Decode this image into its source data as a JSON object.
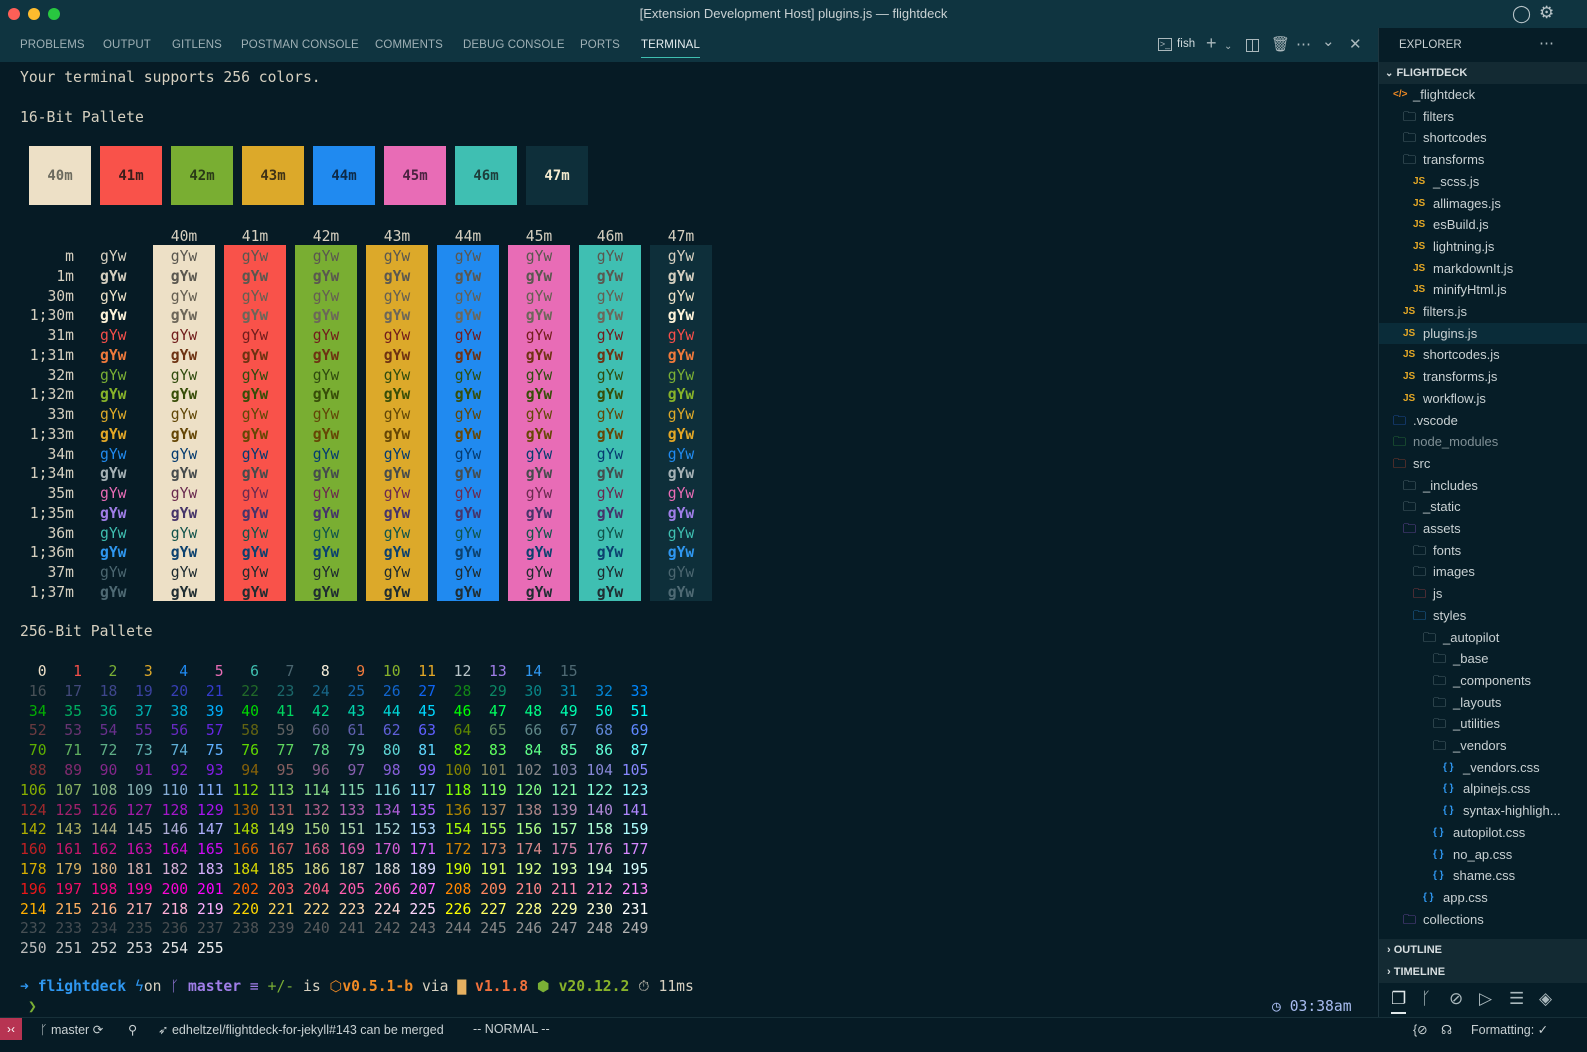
{
  "window": {
    "title": "[Extension Development Host] plugins.js — flightdeck"
  },
  "panel": {
    "tabs": [
      {
        "label": "PROBLEMS"
      },
      {
        "label": "OUTPUT"
      },
      {
        "label": "GITLENS"
      },
      {
        "label": "POSTMAN CONSOLE"
      },
      {
        "label": "COMMENTS"
      },
      {
        "label": "DEBUG CONSOLE"
      },
      {
        "label": "PORTS"
      },
      {
        "label": "TERMINAL",
        "active": true
      }
    ],
    "shell_name": "fish"
  },
  "terminal": {
    "intro": "Your terminal supports 256 colors.",
    "heading16": "16-Bit Pallete",
    "heading256": "256-Bit Pallete",
    "swatches": [
      {
        "label": "40m",
        "bg": "#ede0c6",
        "fg": "#6b6a5e"
      },
      {
        "label": "41m",
        "bg": "#f9524a",
        "fg": "#3a1d1a"
      },
      {
        "label": "42m",
        "bg": "#79ae32",
        "fg": "#2a3a17"
      },
      {
        "label": "43m",
        "bg": "#dca92a",
        "fg": "#3f3216"
      },
      {
        "label": "44m",
        "bg": "#208af0",
        "fg": "#0d2a48"
      },
      {
        "label": "45m",
        "bg": "#e86cb6",
        "fg": "#4a2240"
      },
      {
        "label": "46m",
        "bg": "#3fbfb2",
        "fg": "#1d3d3a"
      },
      {
        "label": "47m",
        "bg": "#0e2f3a",
        "fg": "#f5ecd0"
      }
    ],
    "table": {
      "sample": "gYw",
      "rows": [
        {
          "label": "m",
          "fg": "#d6d0c0",
          "bold": false
        },
        {
          "label": "1m",
          "fg": "#d6d0c0",
          "bold": true
        },
        {
          "label": "30m",
          "fg": "#eee2c8",
          "bold": false
        },
        {
          "label": "1;30m",
          "fg": "#fff4da",
          "bold": true
        },
        {
          "label": "31m",
          "fg": "#f44f4a",
          "bold": false
        },
        {
          "label": "1;31m",
          "fg": "#f07a3c",
          "bold": true
        },
        {
          "label": "32m",
          "fg": "#7aaf35",
          "bold": false
        },
        {
          "label": "1;32m",
          "fg": "#88b32a",
          "bold": true
        },
        {
          "label": "33m",
          "fg": "#dca92a",
          "bold": false
        },
        {
          "label": "1;33m",
          "fg": "#e4a826",
          "bold": true
        },
        {
          "label": "34m",
          "fg": "#208af0",
          "bold": false
        },
        {
          "label": "1;34m",
          "fg": "#a6b2b6",
          "bold": true
        },
        {
          "label": "35m",
          "fg": "#e86cb5",
          "bold": false
        },
        {
          "label": "1;35m",
          "fg": "#a07ee8",
          "bold": true
        },
        {
          "label": "36m",
          "fg": "#3fbfb0",
          "bold": false
        },
        {
          "label": "1;36m",
          "fg": "#2f97f0",
          "bold": true
        },
        {
          "label": "37m",
          "fg": "#4b6670",
          "bold": false
        },
        {
          "label": "1;37m",
          "fg": "#4f6a74",
          "bold": true
        }
      ]
    },
    "palette256": {
      "base16": [
        "#eee0c8",
        "#f44f4a",
        "#7aaf35",
        "#dca92a",
        "#208af0",
        "#e86cb5",
        "#3fbfb0",
        "#4b6670",
        "#f5ecd8",
        "#f07a3c",
        "#88b32a",
        "#e4a826",
        "#b8c4c8",
        "#a07ee8",
        "#2f97f0",
        "#4f6a74"
      ],
      "numbers": [
        0,
        1,
        2,
        3,
        4,
        5,
        6,
        7,
        8,
        9,
        10,
        11,
        12,
        13,
        14,
        15,
        16,
        17,
        18,
        19,
        20,
        21,
        22,
        23,
        24,
        25,
        26,
        27,
        28,
        29,
        30,
        31,
        32,
        33,
        34,
        35,
        36,
        37,
        38,
        39,
        40,
        41,
        42,
        43,
        44,
        45,
        46,
        47,
        48,
        49,
        50,
        51,
        52,
        53,
        54,
        55,
        56,
        57,
        58,
        59,
        60,
        61,
        62,
        63,
        64,
        65,
        66,
        67,
        68,
        69,
        70,
        71,
        72,
        73,
        74,
        75,
        76,
        77,
        78,
        79,
        80,
        81,
        82,
        83,
        84,
        85,
        86,
        87,
        88,
        89,
        90,
        91,
        92,
        93,
        94,
        95,
        96,
        97,
        98,
        99,
        100,
        101,
        102,
        103,
        104,
        105,
        106,
        107,
        108,
        109,
        110,
        111,
        112,
        113,
        114,
        115,
        116,
        117,
        118,
        119,
        120,
        121,
        122,
        123,
        124,
        125,
        126,
        127,
        128,
        129,
        130,
        131,
        132,
        133,
        134,
        135,
        136,
        137,
        138,
        139,
        140,
        141,
        142,
        143,
        144,
        145,
        146,
        147,
        148,
        149,
        150,
        151,
        152,
        153,
        154,
        155,
        156,
        157,
        158,
        159,
        160,
        161,
        162,
        163,
        164,
        165,
        166,
        167,
        168,
        169,
        170,
        171,
        172,
        173,
        174,
        175,
        176,
        177,
        178,
        179,
        180,
        181,
        182,
        183,
        184,
        185,
        186,
        187,
        188,
        189,
        190,
        191,
        192,
        193,
        194,
        195,
        196,
        197,
        198,
        199,
        200,
        201,
        202,
        203,
        204,
        205,
        206,
        207,
        208,
        209,
        210,
        211,
        212,
        213,
        214,
        215,
        216,
        217,
        218,
        219,
        220,
        221,
        222,
        223,
        224,
        225,
        226,
        227,
        228,
        229,
        230,
        231,
        232,
        233,
        234,
        235,
        236,
        237,
        238,
        239,
        240,
        241,
        242,
        243,
        244,
        245,
        246,
        247,
        248,
        249,
        250,
        251,
        252,
        253,
        254,
        255
      ]
    },
    "prompt": {
      "arrow": "➜",
      "dir": "flightdeck",
      "on": "on",
      "branch": "master",
      "git_status": "≡",
      "diff": "+/-",
      "is": "is",
      "pkg_version": "v0.5.1-b",
      "via": "via",
      "bun_version": "v1.1.8",
      "node_version": "v20.12.2",
      "duration": "11ms",
      "caret": "❯",
      "clock": "03:38am"
    }
  },
  "explorer": {
    "title": "EXPLORER",
    "root": "FLIGHTDECK",
    "items": [
      {
        "name": "_flightdeck",
        "level": 0,
        "icon": "code-folder"
      },
      {
        "name": "filters",
        "level": 1,
        "icon": "folder"
      },
      {
        "name": "shortcodes",
        "level": 1,
        "icon": "folder"
      },
      {
        "name": "transforms",
        "level": 1,
        "icon": "folder"
      },
      {
        "name": "_scss.js",
        "level": 2,
        "icon": "js"
      },
      {
        "name": "allimages.js",
        "level": 2,
        "icon": "js"
      },
      {
        "name": "esBuild.js",
        "level": 2,
        "icon": "js"
      },
      {
        "name": "lightning.js",
        "level": 2,
        "icon": "js"
      },
      {
        "name": "markdownIt.js",
        "level": 2,
        "icon": "js"
      },
      {
        "name": "minifyHtml.js",
        "level": 2,
        "icon": "js"
      },
      {
        "name": "filters.js",
        "level": 1,
        "icon": "js"
      },
      {
        "name": "plugins.js",
        "level": 1,
        "icon": "js",
        "selected": true
      },
      {
        "name": "shortcodes.js",
        "level": 1,
        "icon": "js"
      },
      {
        "name": "transforms.js",
        "level": 1,
        "icon": "js"
      },
      {
        "name": "workflow.js",
        "level": 1,
        "icon": "js"
      },
      {
        "name": ".vscode",
        "level": 0,
        "icon": "folder-vscode"
      },
      {
        "name": "node_modules",
        "level": 0,
        "icon": "folder-node",
        "dim": true
      },
      {
        "name": "src",
        "level": 0,
        "icon": "folder-src"
      },
      {
        "name": "_includes",
        "level": 1,
        "icon": "folder"
      },
      {
        "name": "_static",
        "level": 1,
        "icon": "folder"
      },
      {
        "name": "assets",
        "level": 1,
        "icon": "folder-assets"
      },
      {
        "name": "fonts",
        "level": 2,
        "icon": "folder"
      },
      {
        "name": "images",
        "level": 2,
        "icon": "folder"
      },
      {
        "name": "js",
        "level": 2,
        "icon": "folder-js"
      },
      {
        "name": "styles",
        "level": 2,
        "icon": "folder-styles"
      },
      {
        "name": "_autopilot",
        "level": 3,
        "icon": "folder"
      },
      {
        "name": "_base",
        "level": 4,
        "icon": "folder"
      },
      {
        "name": "_components",
        "level": 4,
        "icon": "folder"
      },
      {
        "name": "_layouts",
        "level": 4,
        "icon": "folder"
      },
      {
        "name": "_utilities",
        "level": 4,
        "icon": "folder"
      },
      {
        "name": "_vendors",
        "level": 4,
        "icon": "folder"
      },
      {
        "name": "_vendors.css",
        "level": 5,
        "icon": "css"
      },
      {
        "name": "alpinejs.css",
        "level": 5,
        "icon": "css"
      },
      {
        "name": "syntax-highligh...",
        "level": 5,
        "icon": "css"
      },
      {
        "name": "autopilot.css",
        "level": 4,
        "icon": "css"
      },
      {
        "name": "no_ap.css",
        "level": 4,
        "icon": "css"
      },
      {
        "name": "shame.css",
        "level": 4,
        "icon": "css"
      },
      {
        "name": "app.css",
        "level": 3,
        "icon": "css"
      },
      {
        "name": "collections",
        "level": 1,
        "icon": "folder-collections"
      }
    ],
    "outline": "OUTLINE",
    "timeline": "TIMELINE"
  },
  "statusbar": {
    "branch": "master",
    "pr": "edheltzel/flightdeck-for-jekyll#143 can be merged",
    "mode": "-- NORMAL --",
    "formatting": "Formatting: ✓",
    "remote_color": "#b73452"
  }
}
